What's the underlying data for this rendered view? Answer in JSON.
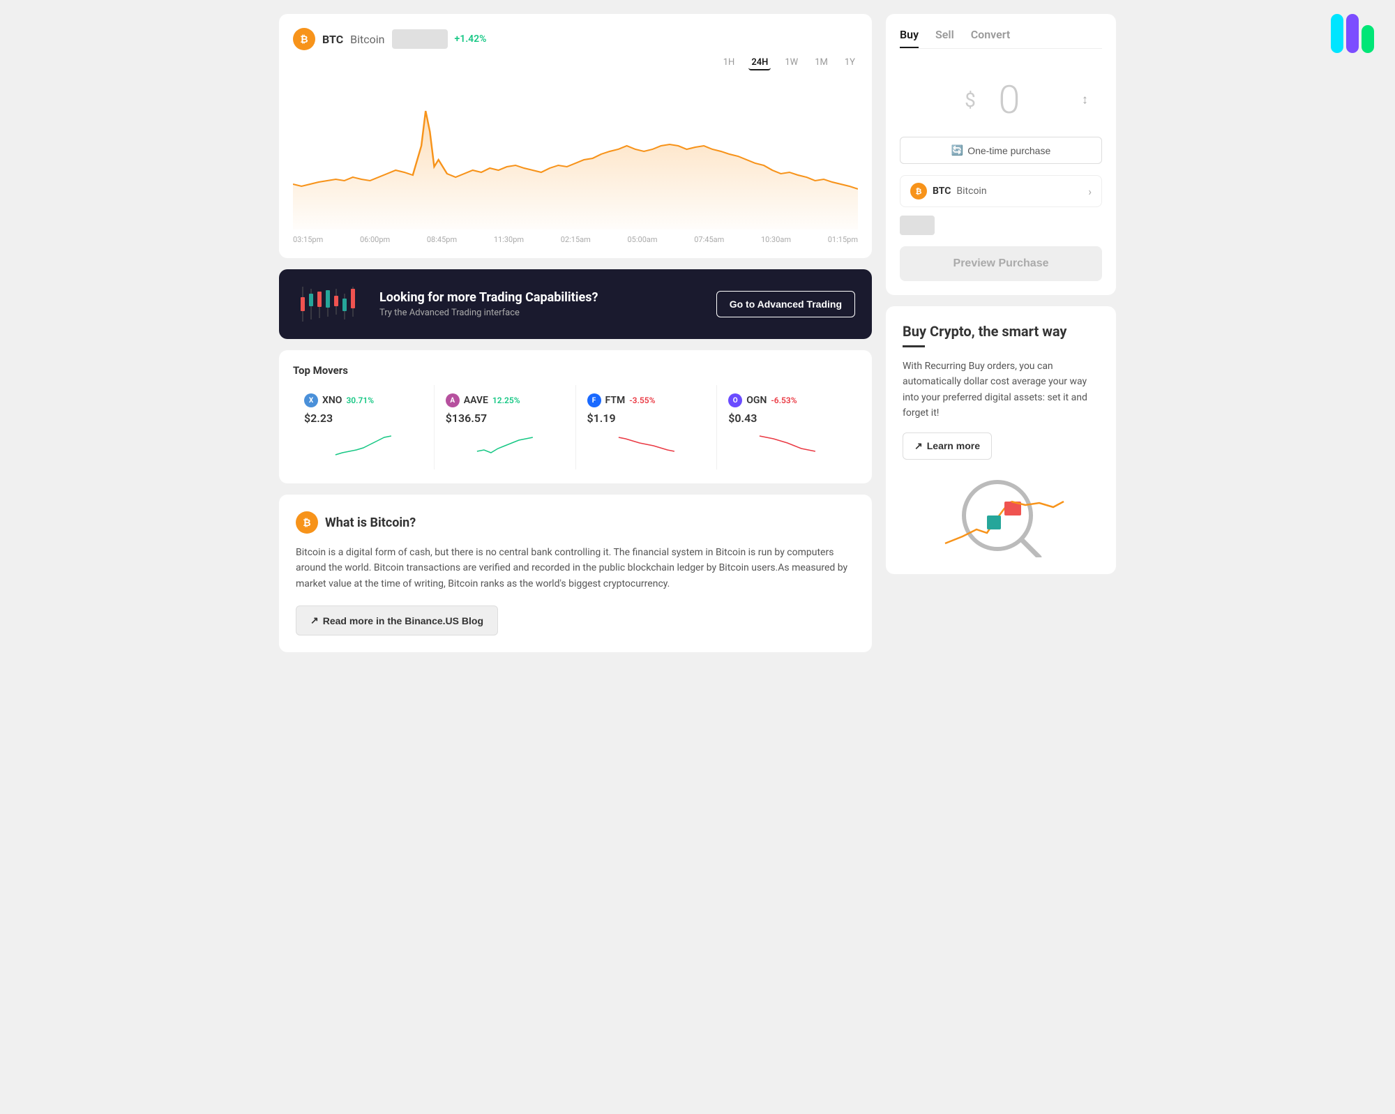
{
  "header": {
    "logo_bars": [
      "#00e5ff",
      "#7c4dff",
      "#00e676"
    ]
  },
  "chart": {
    "symbol": "BTC",
    "name": "Bitcoin",
    "icon_text": "₿",
    "price_change": "+1.42%",
    "timeframes": [
      "1H",
      "24H",
      "1W",
      "1M",
      "1Y"
    ],
    "active_timeframe": "24H",
    "time_labels": [
      "03:15pm",
      "06:00pm",
      "08:45pm",
      "11:30pm",
      "02:15am",
      "05:00am",
      "07:45am",
      "10:30am",
      "01:15pm"
    ]
  },
  "banner": {
    "title": "Looking for more Trading Capabilities?",
    "subtitle": "Try the Advanced Trading interface",
    "button_label": "Go to Advanced Trading"
  },
  "top_movers": {
    "title": "Top Movers",
    "items": [
      {
        "symbol": "XNO",
        "name": "XNO",
        "change": "30.71%",
        "positive": true,
        "price": "$2.23",
        "icon_color": "#4a90d9",
        "icon_text": "X"
      },
      {
        "symbol": "AAVE",
        "name": "AAVE",
        "change": "12.25%",
        "positive": true,
        "price": "$136.57",
        "icon_color": "#b6509e",
        "icon_text": "A"
      },
      {
        "symbol": "FTM",
        "name": "FTM",
        "change": "-3.55%",
        "positive": false,
        "price": "$1.19",
        "icon_color": "#1969ff",
        "icon_text": "F"
      },
      {
        "symbol": "OGN",
        "name": "OGN",
        "change": "-6.53%",
        "positive": false,
        "price": "$0.43",
        "icon_color": "#6a4cff",
        "icon_text": "O"
      }
    ]
  },
  "what_is_bitcoin": {
    "title": "What is Bitcoin?",
    "text": "Bitcoin is a digital form of cash, but there is no central bank controlling it. The financial system in Bitcoin is run by computers around the world. Bitcoin transactions are verified and recorded in the public blockchain ledger by Bitcoin users.As measured by market value at the time of writing, Bitcoin ranks as the world's biggest cryptocurrency.",
    "blog_button": "Read more in the Binance.US Blog"
  },
  "trade": {
    "tabs": [
      "Buy",
      "Sell",
      "Convert"
    ],
    "active_tab": "Buy",
    "amount": "0",
    "currency_symbol": "$",
    "purchase_type": "One-time purchase",
    "coin_symbol": "BTC",
    "coin_name": "Bitcoin",
    "preview_button": "Preview Purchase",
    "swap_icon": "↕"
  },
  "promo": {
    "title": "Buy Crypto, the smart way",
    "text": "With Recurring Buy orders, you can automatically dollar cost average your way into your preferred digital assets: set it and forget it!",
    "learn_more": "Learn more",
    "arrow_icon": "↗"
  }
}
